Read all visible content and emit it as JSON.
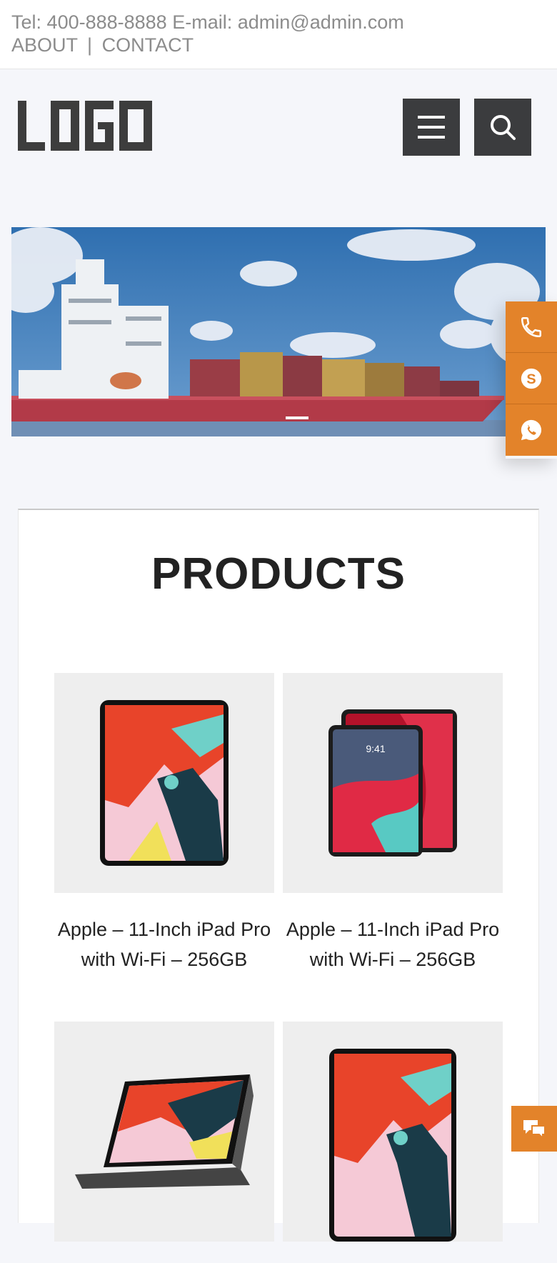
{
  "topbar": {
    "tel_label": "Tel:",
    "tel_value": "400-888-8888",
    "email_label": "E-mail:",
    "email_value": "admin@admin.com",
    "about_link": "ABOUT",
    "separator": "|",
    "contact_link": "CONTACT"
  },
  "header": {
    "logo_text": "LOGO",
    "menu_icon": "hamburger-menu-icon",
    "search_icon": "search-icon"
  },
  "banner": {
    "image": "cargo-ship-with-containers",
    "active_slide": 1
  },
  "contact_rail": {
    "items": [
      "phone-icon",
      "skype-icon",
      "whatsapp-icon"
    ],
    "color": "#e3832a"
  },
  "products": {
    "title": "PRODUCTS",
    "items": [
      {
        "name": "Apple – 11-Inch iPad Pro with Wi-Fi – 256GB",
        "image": "ipad-front-colorful"
      },
      {
        "name": "Apple – 11-Inch iPad Pro with Wi-Fi – 256GB",
        "image": "two-ipads-lockscreen"
      },
      {
        "name": "",
        "image": "ipad-in-stand-case"
      },
      {
        "name": "",
        "image": "ipad-front-colorful"
      }
    ]
  },
  "chat": {
    "icon": "chat-bubble-icon"
  }
}
